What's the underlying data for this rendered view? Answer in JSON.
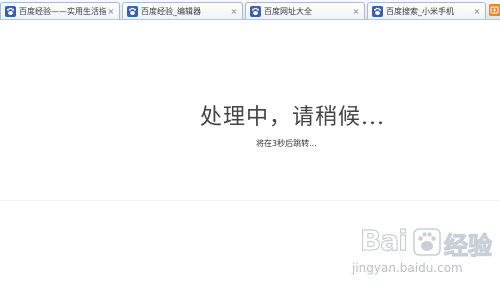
{
  "tabs": [
    {
      "label": "百度经验——实用生活指南",
      "close": "×",
      "icon": "baidu-paw-icon"
    },
    {
      "label": "百度经验_编辑器",
      "close": "×",
      "icon": "baidu-paw-icon"
    },
    {
      "label": "百度网址大全",
      "close": "×",
      "icon": "baidu-paw-icon"
    },
    {
      "label": "百度搜索_小米手机",
      "close": "×",
      "icon": "baidu-paw-icon"
    }
  ],
  "message": {
    "title": "处理中，请稍候...",
    "subtitle": "将在3秒后跳转..."
  },
  "watermark": {
    "logo_text": "Bai",
    "logo_text_after": "经验",
    "url": "jingyan.baidu.com"
  },
  "colors": {
    "tab_border": "#a9b9cf",
    "favicon": "#3a5fb0",
    "new_tab_accent": "#e8862c",
    "watermark_gray": "#c9cfd8"
  }
}
